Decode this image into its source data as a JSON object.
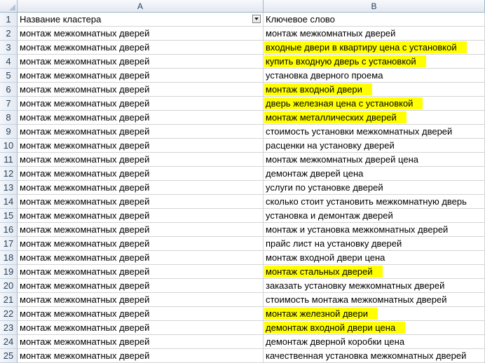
{
  "columns": [
    "A",
    "B"
  ],
  "header_row": {
    "number": "1",
    "col_a": "Название кластера",
    "col_b": "Ключевое слово",
    "filter_icon": "dropdown-arrow-icon"
  },
  "highlight_color": "#ffff00",
  "rows": [
    {
      "num": "2",
      "cluster": "монтаж межкомнатных дверей",
      "keyword": "монтаж межкомнатных дверей",
      "highlight": false
    },
    {
      "num": "3",
      "cluster": "монтаж межкомнатных дверей",
      "keyword": "входные двери в квартиру цена с установкой",
      "highlight": true
    },
    {
      "num": "4",
      "cluster": "монтаж межкомнатных дверей",
      "keyword": "купить входную дверь с установкой",
      "highlight": true
    },
    {
      "num": "5",
      "cluster": "монтаж межкомнатных дверей",
      "keyword": "установка дверного проема",
      "highlight": false
    },
    {
      "num": "6",
      "cluster": "монтаж межкомнатных дверей",
      "keyword": "монтаж входной двери",
      "highlight": true
    },
    {
      "num": "7",
      "cluster": "монтаж межкомнатных дверей",
      "keyword": "дверь железная цена с установкой",
      "highlight": true
    },
    {
      "num": "8",
      "cluster": "монтаж межкомнатных дверей",
      "keyword": "монтаж металлических дверей",
      "highlight": true
    },
    {
      "num": "9",
      "cluster": "монтаж межкомнатных дверей",
      "keyword": "стоимость установки межкомнатных дверей",
      "highlight": false
    },
    {
      "num": "10",
      "cluster": "монтаж межкомнатных дверей",
      "keyword": "расценки на установку дверей",
      "highlight": false
    },
    {
      "num": "11",
      "cluster": "монтаж межкомнатных дверей",
      "keyword": "монтаж межкомнатных дверей цена",
      "highlight": false
    },
    {
      "num": "12",
      "cluster": "монтаж межкомнатных дверей",
      "keyword": "демонтаж дверей цена",
      "highlight": false
    },
    {
      "num": "13",
      "cluster": "монтаж межкомнатных дверей",
      "keyword": "услуги по установке дверей",
      "highlight": false
    },
    {
      "num": "14",
      "cluster": "монтаж межкомнатных дверей",
      "keyword": "сколько стоит установить межкомнатную дверь",
      "highlight": false
    },
    {
      "num": "15",
      "cluster": "монтаж межкомнатных дверей",
      "keyword": "установка и демонтаж дверей",
      "highlight": false
    },
    {
      "num": "16",
      "cluster": "монтаж межкомнатных дверей",
      "keyword": "монтаж и установка межкомнатных дверей",
      "highlight": false
    },
    {
      "num": "17",
      "cluster": "монтаж межкомнатных дверей",
      "keyword": "прайс лист на установку дверей",
      "highlight": false
    },
    {
      "num": "18",
      "cluster": "монтаж межкомнатных дверей",
      "keyword": "монтаж входной двери цена",
      "highlight": false
    },
    {
      "num": "19",
      "cluster": "монтаж межкомнатных дверей",
      "keyword": "монтаж стальных дверей",
      "highlight": true
    },
    {
      "num": "20",
      "cluster": "монтаж межкомнатных дверей",
      "keyword": "заказать установку межкомнатных дверей",
      "highlight": false
    },
    {
      "num": "21",
      "cluster": "монтаж межкомнатных дверей",
      "keyword": "стоимость монтажа межкомнатных дверей",
      "highlight": false
    },
    {
      "num": "22",
      "cluster": "монтаж межкомнатных дверей",
      "keyword": "монтаж железной двери",
      "highlight": true
    },
    {
      "num": "23",
      "cluster": "монтаж межкомнатных дверей",
      "keyword": "демонтаж входной двери цена",
      "highlight": true
    },
    {
      "num": "24",
      "cluster": "монтаж межкомнатных дверей",
      "keyword": "демонтаж дверной коробки цена",
      "highlight": false
    },
    {
      "num": "25",
      "cluster": "монтаж межкомнатных дверей",
      "keyword": "качественная установка межкомнатных дверей",
      "highlight": false
    }
  ]
}
